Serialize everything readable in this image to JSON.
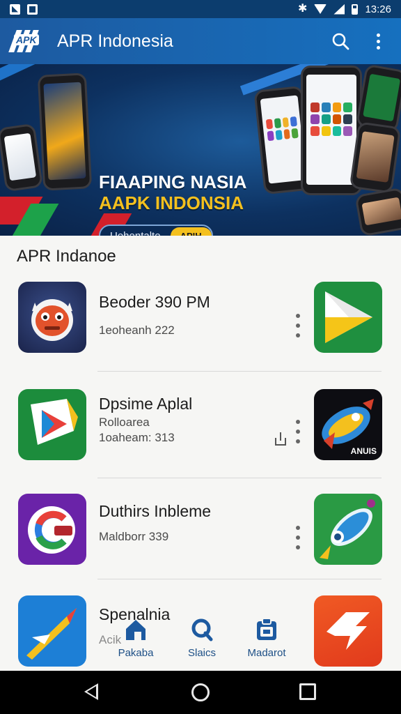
{
  "status_bar": {
    "time": "13:26"
  },
  "app_bar": {
    "logo_text": "APK",
    "title": "APR Indonesia",
    "search_icon": "search-icon",
    "more_icon": "more-vert-icon"
  },
  "banner": {
    "headline_line1": "FIAAPING NASIA",
    "headline_line2": "AAPK INDONSIA",
    "pill_text": "Uehentalte",
    "pill_cta": "APIH",
    "pages": 3,
    "active_page": 0
  },
  "section": {
    "title": "APR Indanoe"
  },
  "apps": [
    {
      "name": "Beoder 390 PM",
      "subtitle": "",
      "meta": "1eoheanh 222",
      "icon": "monkey-mask-app-icon",
      "right_icon": "play-store-icon"
    },
    {
      "name": "Dpsime Aplal",
      "subtitle": "Rolloarea",
      "meta": "1oaheam: 313",
      "icon": "play-app-icon",
      "right_icon": "rocket-game-icon",
      "right_icon_label": "ANUIS"
    },
    {
      "name": "Duthirs Inbleme",
      "subtitle": "",
      "meta": "Maldborr 339",
      "icon": "c-logo-app-icon",
      "right_icon": "rocket-app-icon"
    },
    {
      "name": "Spenalnia",
      "subtitle": "",
      "meta": "Acik",
      "icon": "jet-app-icon",
      "right_icon": "arrows-app-icon"
    }
  ],
  "bottom_nav": [
    {
      "label": "Pakaba",
      "icon": "home-icon"
    },
    {
      "label": "Slaics",
      "icon": "search-icon"
    },
    {
      "label": "Madarot",
      "icon": "clipboard-icon"
    }
  ],
  "colors": {
    "primary": "#1670bf",
    "accent": "#f4c01e",
    "banner_bg": "#0d3160"
  }
}
